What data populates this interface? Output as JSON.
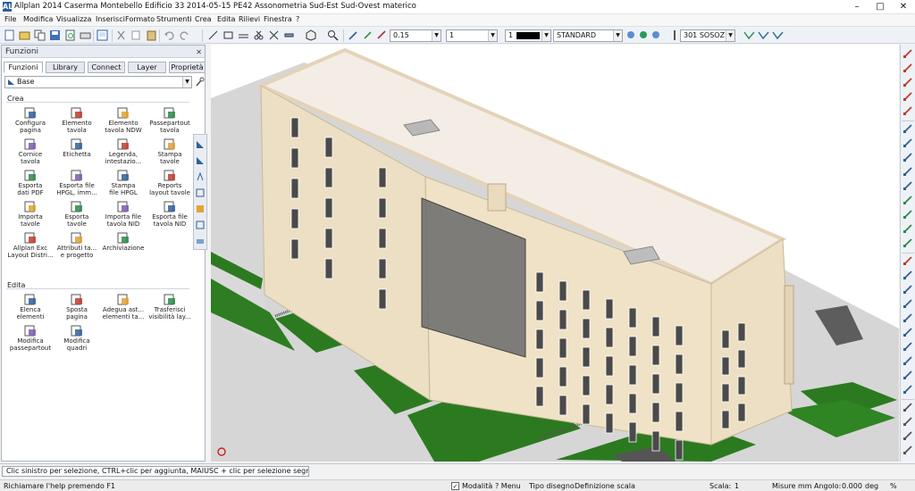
{
  "window": {
    "title": "Allplan 2014   Caserma Montebello   Edificio 33   2014-05-15   PE42   Assonometria Sud-Est Sud-Ovest materico",
    "app_icon": "AL",
    "controls": {
      "minimize": "–",
      "maximize": "□",
      "close": "✕"
    }
  },
  "menu": [
    "File",
    "Modifica",
    "Visualizza",
    "Inserisci",
    "Formato",
    "Strumenti",
    "Crea",
    "Edita",
    "Rilievi",
    "Finestra",
    "?"
  ],
  "toolbar": {
    "pen_value": "0.15",
    "line_value": "1",
    "color_value": "1",
    "style_value": "STANDARD",
    "layer_value": "301 SOSOZ"
  },
  "panel": {
    "title": "Funzioni",
    "close": "✕",
    "tabs": [
      "Funzioni",
      "Library",
      "Connect",
      "Layer",
      "Proprietà"
    ],
    "combo_value": "Base",
    "sections": [
      {
        "title": "Crea",
        "items": [
          {
            "label1": "Configura",
            "label2": "pagina",
            "icon": "page-setup-icon"
          },
          {
            "label1": "Elemento",
            "label2": "tavola",
            "icon": "layout-element-icon"
          },
          {
            "label1": "Elemento",
            "label2": "tavola NDW",
            "icon": "layout-ndw-icon"
          },
          {
            "label1": "Passepartout",
            "label2": "tavola",
            "icon": "passepartout-icon"
          },
          {
            "label1": "Cornice",
            "label2": "tavola",
            "icon": "frame-icon"
          },
          {
            "label1": "Etichetta",
            "label2": "",
            "icon": "label-icon"
          },
          {
            "label1": "Legenda,",
            "label2": "intestazio...",
            "icon": "legend-icon"
          },
          {
            "label1": "Stampa",
            "label2": "tavole",
            "icon": "print-icon"
          },
          {
            "label1": "Esporta",
            "label2": "dati PDF",
            "icon": "pdf-export-icon"
          },
          {
            "label1": "Esporta file",
            "label2": "HPGL, imm...",
            "icon": "hpgl-export-icon"
          },
          {
            "label1": "Stampa",
            "label2": "file HPGL",
            "icon": "print-hpgl-icon"
          },
          {
            "label1": "Reports",
            "label2": "layout tavole",
            "icon": "reports-icon"
          },
          {
            "label1": "Importa",
            "label2": "tavole",
            "icon": "import-icon"
          },
          {
            "label1": "Esporta",
            "label2": "tavole",
            "icon": "export-icon"
          },
          {
            "label1": "Importa file",
            "label2": "tavola NID",
            "icon": "import-nid-icon"
          },
          {
            "label1": "Esporta file",
            "label2": "tavola NID",
            "icon": "export-nid-icon"
          },
          {
            "label1": "Allplan Exc",
            "label2": "Layout Distri...",
            "icon": "exchange-icon"
          },
          {
            "label1": "Attributi ta...",
            "label2": "e progetto",
            "icon": "attributes-icon"
          },
          {
            "label1": "Archiviazione",
            "label2": "",
            "icon": "archive-icon"
          }
        ]
      },
      {
        "title": "Edita",
        "items": [
          {
            "label1": "Elenca",
            "label2": "elementi",
            "icon": "list-icon"
          },
          {
            "label1": "Sposta",
            "label2": "pagina",
            "icon": "move-page-icon"
          },
          {
            "label1": "Adegua ast...",
            "label2": "elementi ta...",
            "icon": "adapt-icon"
          },
          {
            "label1": "Trasferisci",
            "label2": "visibilità lay...",
            "icon": "transfer-icon"
          },
          {
            "label1": "Modifica",
            "label2": "passepartout",
            "icon": "edit-passepartout-icon"
          },
          {
            "label1": "Modifica",
            "label2": "quadri",
            "icon": "edit-frames-icon"
          }
        ]
      }
    ]
  },
  "prompt": "Clic sinistro per selezione, CTRL+clic per aggiunta, MAIUSC + clic per selezione segmento",
  "status": {
    "help": "Richiamare l'help premendo F1",
    "modalita": "Modalità",
    "menu": "? Menu",
    "tipo_disegno": "Tipo disegno",
    "definizione_scala": "Definizione scala",
    "scala_label": "Scala:",
    "scala_value": "1",
    "misure_label": "Misure",
    "misure_value": "mm",
    "angolo_label": "Angolo:",
    "angolo_value": "0.000",
    "deg": "deg",
    "percent": "%"
  },
  "colors": {
    "facade": "#eddfc3",
    "roof": "#f3ece5",
    "lawn": "#2d7a1f",
    "ground": "#c9c9c9",
    "panel_head": "#e7ecf4"
  }
}
